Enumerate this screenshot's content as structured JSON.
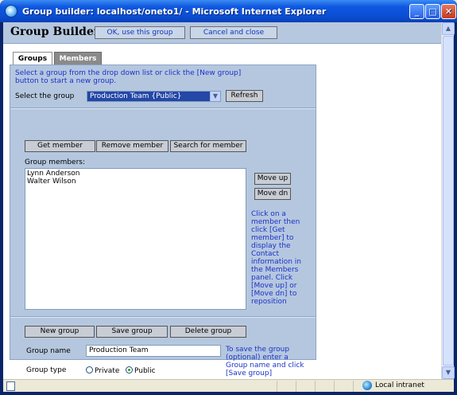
{
  "window": {
    "title": "Group builder: localhost/oneto1/ - Microsoft Internet Explorer"
  },
  "header": {
    "title": "Group Builder",
    "ok_label": "OK, use this group",
    "cancel_label": "Cancel and close"
  },
  "tabs": [
    {
      "label": "Groups",
      "active": true
    },
    {
      "label": "Members",
      "active": false
    }
  ],
  "select_section": {
    "instructions": "Select a group from the drop down list or click the [New group] button to start a new group.",
    "select_label": "Select the group",
    "selected_value": "Production Team {Public}",
    "refresh_label": "Refresh"
  },
  "members_section": {
    "get_member_label": "Get member",
    "remove_member_label": "Remove member",
    "search_member_label": "Search for member",
    "members_label": "Group members:",
    "members": [
      "Lynn Anderson",
      "Walter Wilson"
    ],
    "move_up_label": "Move up",
    "move_dn_label": "Move dn",
    "help_text": "Click on a member then click [Get member] to display the Contact information in the Members panel. Click [Move up] or [Move dn] to reposition"
  },
  "group_section": {
    "new_group_label": "New group",
    "save_group_label": "Save group",
    "delete_group_label": "Delete group",
    "name_label": "Group name",
    "name_value": "Production Team",
    "type_label": "Group type",
    "type_options": [
      "Private",
      "Public"
    ],
    "type_selected": "Public",
    "save_help": "To save the group (optional) enter a Group name and click [Save group]"
  },
  "statusbar": {
    "zone": "Local intranet"
  },
  "colors": {
    "panel_bg": "#B5C7DF",
    "help_text": "#1B32C8",
    "titlebar": "#0A4FD5"
  }
}
